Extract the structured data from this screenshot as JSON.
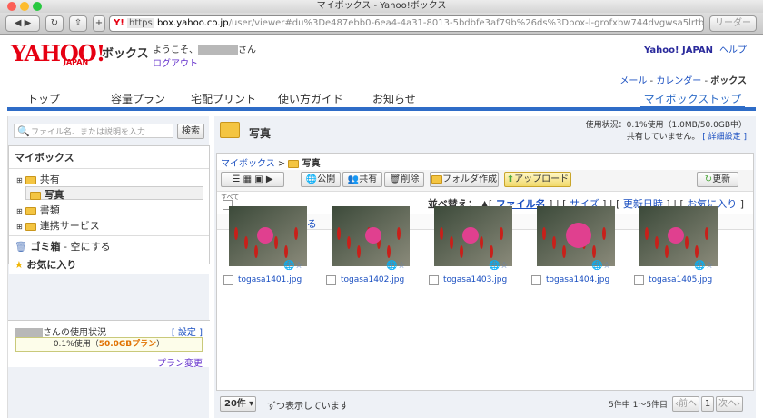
{
  "window": {
    "title": "マイボックス - Yahoo!ボックス"
  },
  "browser": {
    "url_scheme": "https",
    "url_host": "box.yahoo.co.jp",
    "url_path": "/user/viewer#du%3De487ebb0-6ea4-4a31-8013-5bdbfe3af79b%26ds%3Dbox-l-grofxbw744dvgwsa5lrtbkvfey-10(",
    "reader_label": "リーダー"
  },
  "header": {
    "logo": "YAHOO!",
    "logo_sub": "JAPAN",
    "brand": "ボックス",
    "welcome": "ようこそ、",
    "welcome_suffix": "さん",
    "logout": "ログアウト",
    "yahoo_japan": "Yahoo! JAPAN",
    "help": "ヘルプ",
    "mail": "メール",
    "calendar": "カレンダー",
    "box": "ボックス",
    "sep": "-"
  },
  "nav": {
    "tabs": [
      "トップ",
      "容量プラン",
      "宅配プリント",
      "使い方ガイド",
      "お知らせ"
    ],
    "active": "マイボックストップ"
  },
  "sidebar": {
    "search_placeholder": "ファイル名、または説明を入力",
    "search_button": "検索",
    "mybox_title": "マイボックス",
    "tree": [
      {
        "label": "共有"
      },
      {
        "label": "写真"
      },
      {
        "label": "書類"
      },
      {
        "label": "連携サービス"
      }
    ],
    "trash": "ゴミ箱",
    "trash_action": "空にする",
    "trash_sep": "-",
    "favorites": "お気に入り",
    "usage_suffix": "さんの使用状況",
    "settings": "[ 設定 ]",
    "usage_text": "0.1%使用（",
    "usage_plan": "50.0GBプラン",
    "usage_close": "）",
    "plan_change": "プラン変更"
  },
  "main": {
    "folder_title": "写真",
    "status": "使用状況：0.1%使用（1.0MB/50.0GB中）",
    "share_status": "共有していません。",
    "detail_settings": "[ 詳細設定 ]",
    "breadcrumb_root": "マイボックス",
    "breadcrumb_sep": ">",
    "breadcrumb_current": "写真",
    "buttons": {
      "public": "公開",
      "share": "共有",
      "delete": "削除",
      "new_folder": "フォルダ作成",
      "upload": "アップロード",
      "refresh": "更新"
    },
    "select_all": "すべて",
    "sort_label": "並べ替え：",
    "sort_options": [
      "ファイル名",
      "サイズ",
      "更新日時",
      "お気に入り"
    ],
    "up": "上の階層へ戻る",
    "files": [
      {
        "name": "togasa1401.jpg"
      },
      {
        "name": "togasa1402.jpg"
      },
      {
        "name": "togasa1403.jpg"
      },
      {
        "name": "togasa1404.jpg"
      },
      {
        "name": "togasa1405.jpg"
      }
    ],
    "per_page": "20件",
    "per_page_suffix": "ずつ表示しています",
    "count": "5件中 1〜5件目",
    "prev": "前へ",
    "page": "1",
    "next": "次へ"
  },
  "colors": {
    "accent": "#2e6cc7",
    "yahoo_red": "#e60012",
    "plan_orange": "#e07000",
    "upload_green": "#4fa83d"
  }
}
